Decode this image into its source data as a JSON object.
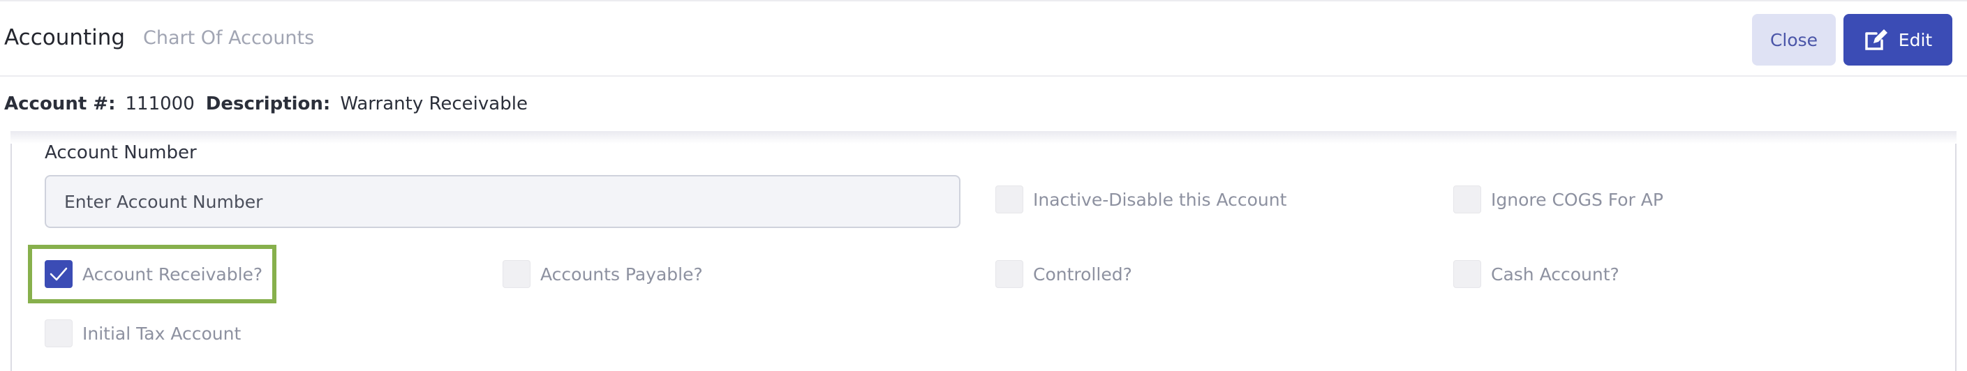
{
  "header": {
    "app_title": "Accounting",
    "breadcrumb": "Chart Of Accounts",
    "close_label": "Close",
    "edit_label": "Edit"
  },
  "info": {
    "account_label": "Account #:",
    "account_value": "111000",
    "description_label": "Description:",
    "description_value": "Warranty Receivable"
  },
  "form": {
    "account_number_label": "Account Number",
    "account_number_placeholder": "Enter Account Number",
    "account_number_value": "",
    "checkboxes": {
      "inactive": {
        "label": "Inactive-Disable this Account",
        "checked": false
      },
      "ignore_cogs": {
        "label": "Ignore COGS For AP",
        "checked": false
      },
      "account_receivable": {
        "label": "Account Receivable?",
        "checked": true
      },
      "accounts_payable": {
        "label": "Accounts Payable?",
        "checked": false
      },
      "controlled": {
        "label": "Controlled?",
        "checked": false
      },
      "cash_account": {
        "label": "Cash Account?",
        "checked": false
      },
      "initial_tax": {
        "label": "Initial Tax Account",
        "checked": false
      }
    }
  },
  "colors": {
    "primary": "#3b4cb5",
    "highlight": "#87b04c",
    "close_bg": "#dfe2f4"
  },
  "icons": {
    "edit": "edit-pencil-icon",
    "check": "checkmark-icon"
  }
}
